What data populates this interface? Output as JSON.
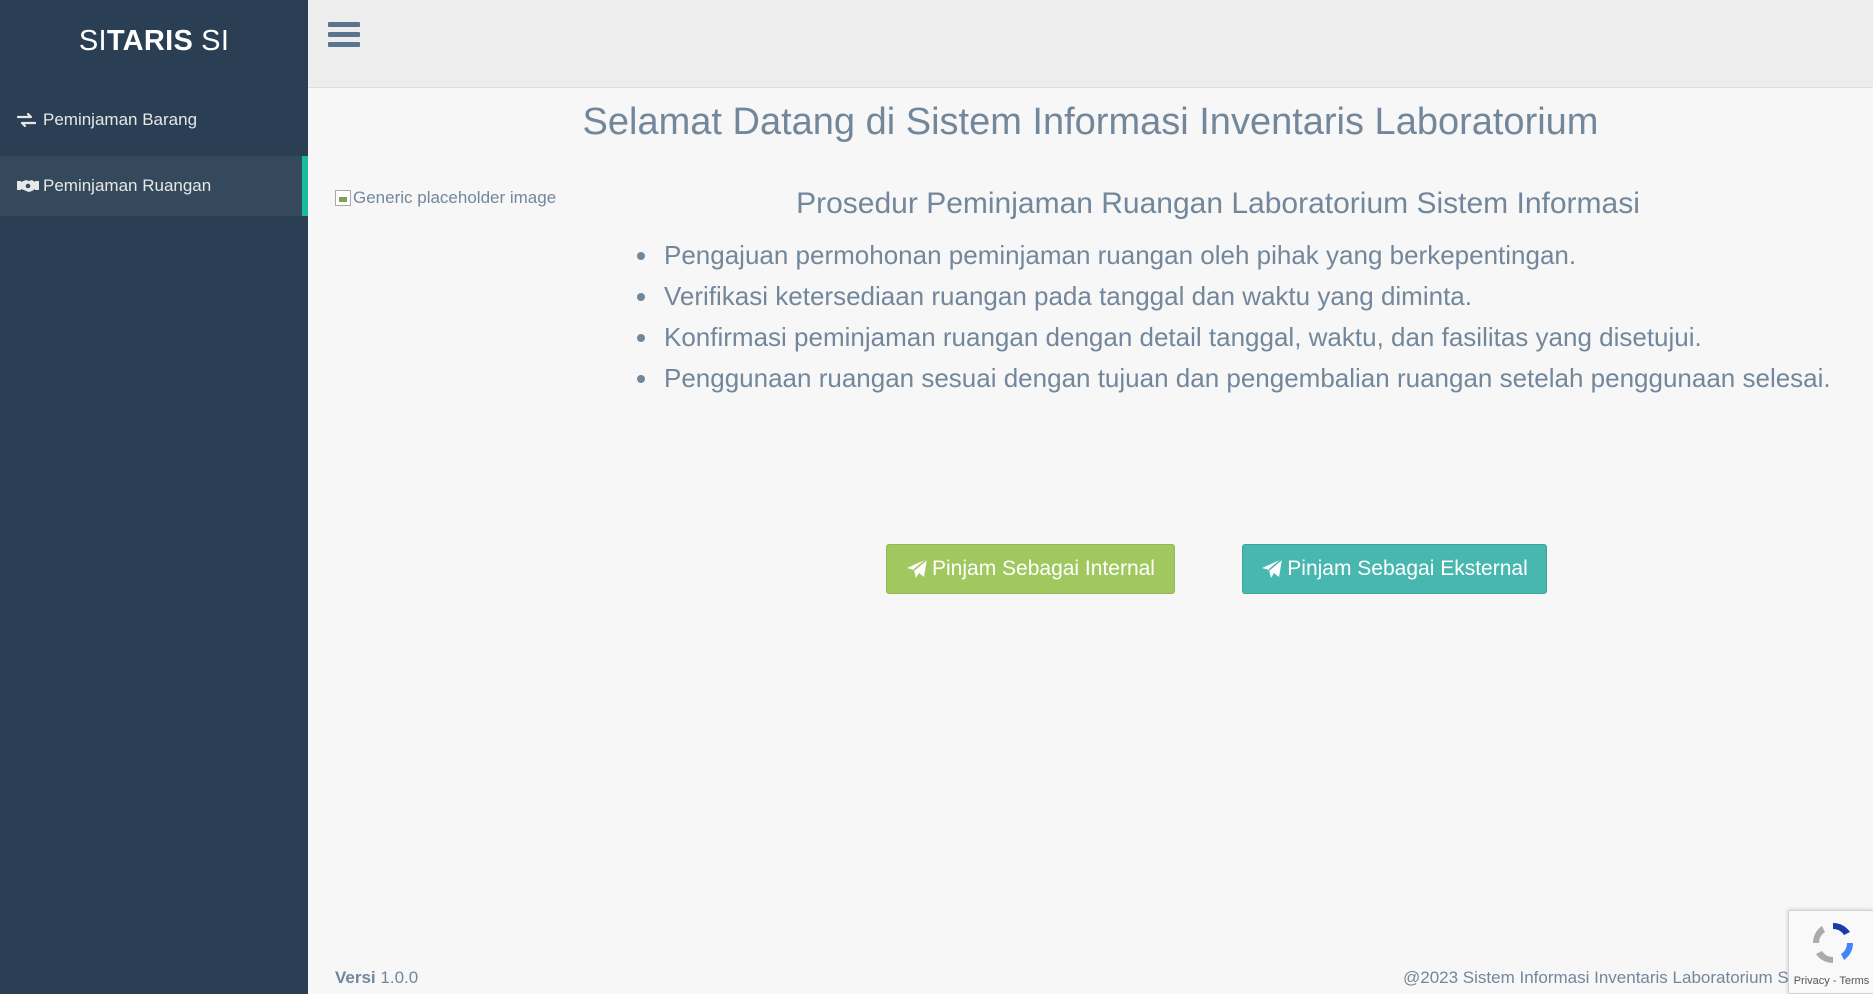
{
  "brand": {
    "part1": "SI",
    "part2": "TARIS",
    "part3": "SI"
  },
  "sidebar": {
    "items": [
      {
        "label": "Peminjaman Barang",
        "icon": "exchange-icon"
      },
      {
        "label": "Peminjaman Ruangan",
        "icon": "handshake-icon",
        "active": true
      }
    ]
  },
  "main": {
    "title": "Selamat Datang di Sistem Informasi Inventaris Laboratorium",
    "image_alt": "Generic placeholder image",
    "procedure_title": "Prosedur Peminjaman Ruangan Laboratorium Sistem Informasi",
    "steps": [
      "Pengajuan permohonan peminjaman ruangan oleh pihak yang berkepentingan.",
      "Verifikasi ketersediaan ruangan pada tanggal dan waktu yang diminta.",
      "Konfirmasi peminjaman ruangan dengan detail tanggal, waktu, dan fasilitas yang disetujui.",
      "Penggunaan ruangan sesuai dengan tujuan dan pengembalian ruangan setelah penggunaan selesai."
    ],
    "btn_internal": "Pinjam Sebagai Internal",
    "btn_external": "Pinjam Sebagai Eksternal"
  },
  "footer": {
    "version_label": "Versi",
    "version": "1.0.0",
    "copyright": "@2023 Sistem Informasi Inventaris Laboratorium Sistem Informasi"
  },
  "recaptcha": {
    "links": "Privacy - Terms"
  },
  "colors": {
    "sidebar": "#2a3f54",
    "accent": "#1abb9c",
    "internal": "#a0c85f",
    "external": "#48b7b0",
    "text": "#73879c"
  }
}
